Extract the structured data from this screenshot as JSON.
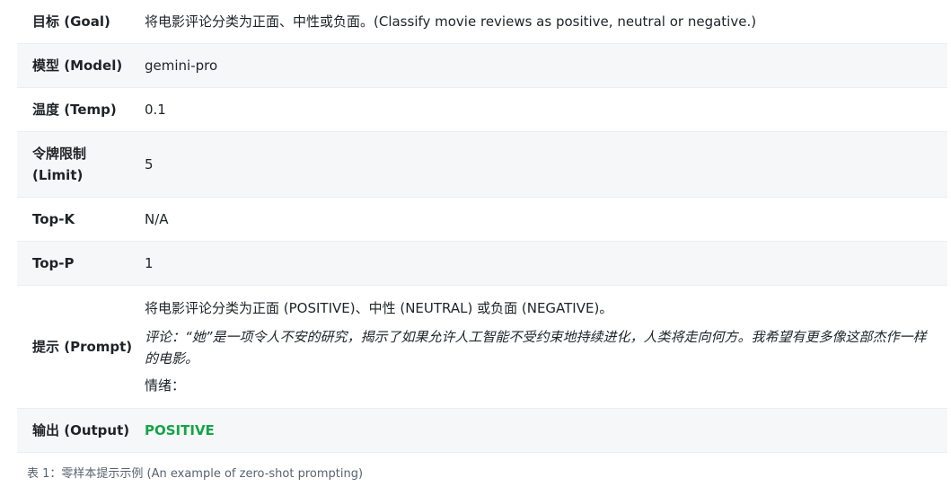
{
  "table": {
    "rows": [
      {
        "key": "目标 (Goal)",
        "value": "将电影评论分类为正面、中性或负面。(Classify movie reviews as positive, neutral or negative.)"
      },
      {
        "key": "模型 (Model)",
        "value": "gemini-pro"
      },
      {
        "key": "温度 (Temp)",
        "value": "0.1"
      },
      {
        "key_line1": "令牌限制",
        "key_line2": "(Limit)",
        "value": "5"
      },
      {
        "key": "Top-K",
        "value": "N/A"
      },
      {
        "key": "Top-P",
        "value": "1"
      },
      {
        "key": "提示 (Prompt)",
        "prompt_instruction": "将电影评论分类为正面 (POSITIVE)、中性 (NEUTRAL) 或负面 (NEGATIVE)。",
        "prompt_review": "评论：“她”是一项令人不安的研究，揭示了如果允许人工智能不受约束地持续进化，人类将走向何方。我希望有更多像这部杰作一样的电影。",
        "prompt_sentiment": "情绪："
      },
      {
        "key": "输出 (Output)",
        "value": "POSITIVE"
      }
    ]
  },
  "caption": "表 1：零样本提示示例 (An example of zero-shot prompting)",
  "colors": {
    "output": "#16a34a",
    "shaded_row": "#f6f7f8"
  }
}
